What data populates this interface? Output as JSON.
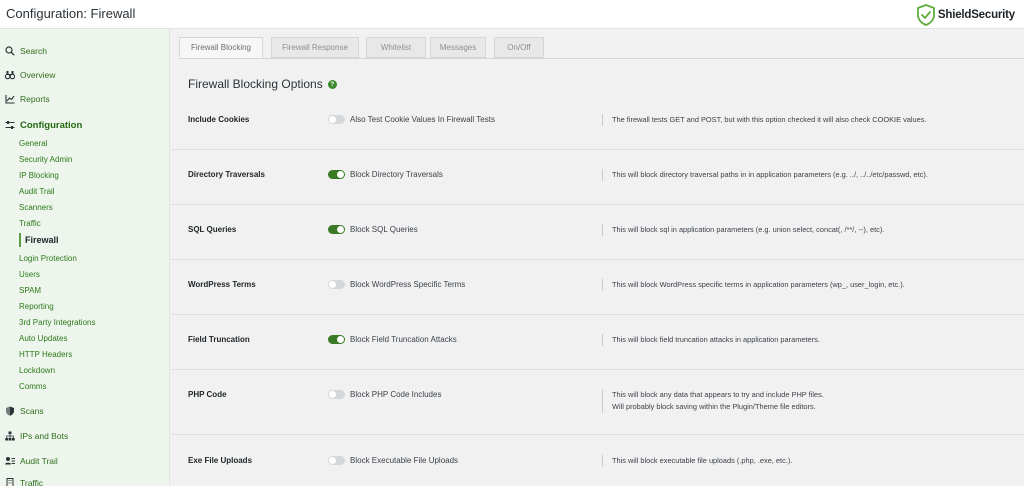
{
  "header": {
    "title": "Configuration: Firewall",
    "brand": "ShieldSecurity"
  },
  "sidebar": {
    "items": [
      {
        "label": "Search",
        "icon": "search-icon",
        "type": "top"
      },
      {
        "label": "Overview",
        "icon": "binoculars-icon",
        "type": "top"
      },
      {
        "label": "Reports",
        "icon": "chart-icon",
        "type": "top"
      },
      {
        "label": "Configuration",
        "icon": "sliders-icon",
        "type": "section"
      },
      {
        "label": "General",
        "type": "sub"
      },
      {
        "label": "Security Admin",
        "type": "sub"
      },
      {
        "label": "IP Blocking",
        "type": "sub"
      },
      {
        "label": "Audit Trail",
        "type": "sub"
      },
      {
        "label": "Scanners",
        "type": "sub"
      },
      {
        "label": "Traffic",
        "type": "sub"
      },
      {
        "label": "Firewall",
        "type": "sub",
        "active": true
      },
      {
        "label": "Login Protection",
        "type": "sub"
      },
      {
        "label": "Users",
        "type": "sub"
      },
      {
        "label": "SPAM",
        "type": "sub"
      },
      {
        "label": "Reporting",
        "type": "sub"
      },
      {
        "label": "3rd Party Integrations",
        "type": "sub"
      },
      {
        "label": "Auto Updates",
        "type": "sub"
      },
      {
        "label": "HTTP Headers",
        "type": "sub"
      },
      {
        "label": "Lockdown",
        "type": "sub"
      },
      {
        "label": "Comms",
        "type": "sub"
      },
      {
        "label": "Scans",
        "icon": "shield-icon",
        "type": "top"
      },
      {
        "label": "IPs and Bots",
        "icon": "network-icon",
        "type": "top"
      },
      {
        "label": "Audit Trail",
        "icon": "user-list-icon",
        "type": "top"
      },
      {
        "label": "Traffic",
        "icon": "building-icon",
        "type": "top"
      }
    ]
  },
  "tabs": [
    {
      "label": "Firewall Blocking",
      "active": true
    },
    {
      "label": "Firewall Response",
      "active": false
    },
    {
      "label": "Whitelist",
      "active": false
    },
    {
      "label": "Messages",
      "active": false
    },
    {
      "label": "On/Off",
      "active": false
    }
  ],
  "main": {
    "section_title": "Firewall Blocking Options",
    "help_icon": "?"
  },
  "options": [
    {
      "label": "Include Cookies",
      "enabled": false,
      "control_label": "Also Test Cookie Values In Firewall Tests",
      "description": [
        "The firewall tests GET and POST, but with this option checked it will also check COOKIE values."
      ]
    },
    {
      "label": "Directory Traversals",
      "enabled": true,
      "control_label": "Block Directory Traversals",
      "description": [
        "This will block directory traversal paths in in application parameters (e.g. ../, ../../etc/passwd, etc)."
      ]
    },
    {
      "label": "SQL Queries",
      "enabled": true,
      "control_label": "Block SQL Queries",
      "description": [
        "This will block sql in application parameters (e.g. union select, concat(, /**/, --), etc)."
      ]
    },
    {
      "label": "WordPress Terms",
      "enabled": false,
      "control_label": "Block WordPress Specific Terms",
      "description": [
        "This will block WordPress specific terms in application parameters (wp_, user_login, etc.)."
      ]
    },
    {
      "label": "Field Truncation",
      "enabled": true,
      "control_label": "Block Field Truncation Attacks",
      "description": [
        "This will block field truncation attacks in application parameters."
      ]
    },
    {
      "label": "PHP Code",
      "enabled": false,
      "control_label": "Block PHP Code Includes",
      "description": [
        "This will block any data that appears to try and include PHP files.",
        "Will probably block saving within the Plugin/Theme file editors."
      ]
    },
    {
      "label": "Exe File Uploads",
      "enabled": false,
      "control_label": "Block Executable File Uploads",
      "description": [
        "This will block executable file uploads (.php, .exe, etc.)."
      ]
    }
  ],
  "colors": {
    "accent": "#3b7a24",
    "sidebar_bg": "#eef5ec",
    "link": "#2c7a1a"
  }
}
